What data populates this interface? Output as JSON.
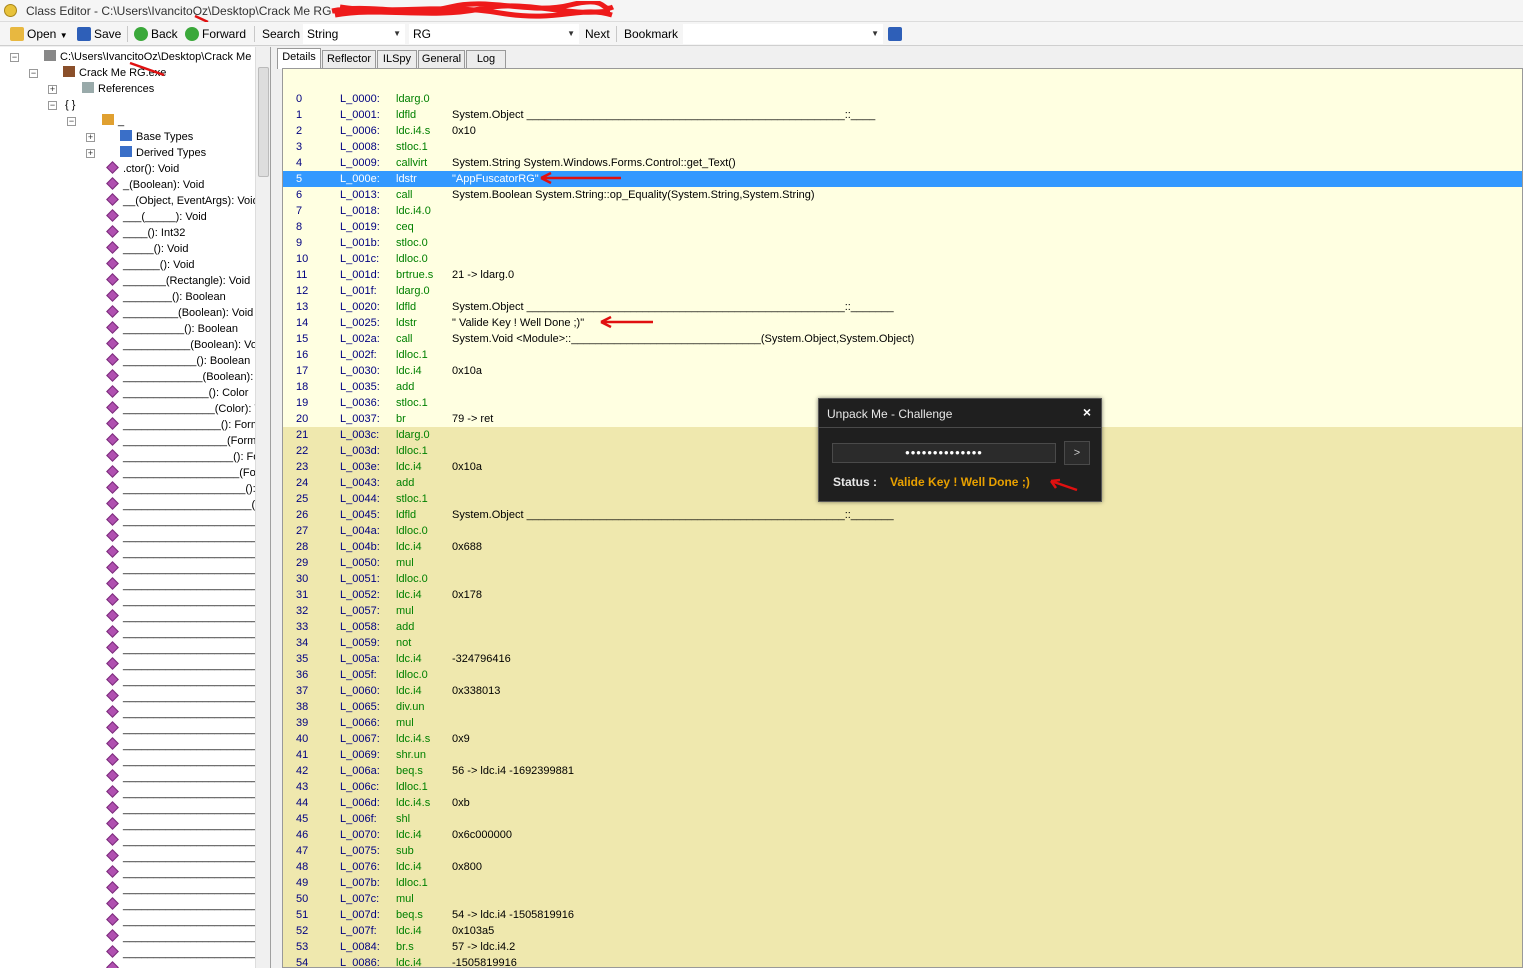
{
  "window": {
    "title": "Class Editor - C:\\Users\\IvancitoOz\\Desktop\\Crack Me RG"
  },
  "toolbar": {
    "open_label": "Open",
    "save_label": "Save",
    "back_label": "Back",
    "forward_label": "Forward",
    "search_label": "Search",
    "search_type": "String",
    "search_value": "RG",
    "next_label": "Next",
    "bookmark_label": "Bookmark",
    "bookmark_value": ""
  },
  "tree": {
    "items": [
      {
        "text": "C:\\Users\\IvancitoOz\\Desktop\\Crack Me RG"
      },
      {
        "text": "Crack Me RG.exe"
      },
      {
        "text": "References"
      },
      {
        "text": "{ }"
      },
      {
        "text": "_"
      },
      {
        "text": "Base Types"
      },
      {
        "text": "Derived Types"
      },
      {
        "text": ".ctor(): Void"
      },
      {
        "text": "_(Boolean): Void"
      },
      {
        "text": "__(Object, EventArgs): Void"
      },
      {
        "text": "___(_____): Void"
      },
      {
        "text": "____(): Int32"
      },
      {
        "text": "_____(): Void"
      },
      {
        "text": "______(): Void"
      },
      {
        "text": "_______(Rectangle): Void"
      },
      {
        "text": "________(): Boolean"
      },
      {
        "text": "_________(Boolean): Void"
      },
      {
        "text": "__________(): Boolean"
      },
      {
        "text": "___________(Boolean): Void"
      },
      {
        "text": "____________(): Boolean"
      },
      {
        "text": "_____________(Boolean): Void"
      },
      {
        "text": "______________(): Color"
      },
      {
        "text": "_______________(Color): Void"
      },
      {
        "text": "________________(): Form"
      },
      {
        "text": "_________________(FormB"
      },
      {
        "text": "__________________(): Fo"
      },
      {
        "text": "___________________(For"
      },
      {
        "text": "____________________(): "
      },
      {
        "text": "_____________________(B"
      }
    ],
    "blank_label": "______________________________"
  },
  "tabs": [
    "Details",
    "Reflector",
    "ILSpy",
    "General",
    "Log"
  ],
  "code": [
    {
      "n": "0",
      "label": "L_0000:",
      "op": "ldarg.0",
      "operand": ""
    },
    {
      "n": "1",
      "label": "L_0001:",
      "op": "ldfld",
      "operand": "System.Object ____________________________________________________::____"
    },
    {
      "n": "2",
      "label": "L_0006:",
      "op": "ldc.i4.s",
      "operand": "0x10"
    },
    {
      "n": "3",
      "label": "L_0008:",
      "op": "stloc.1",
      "operand": ""
    },
    {
      "n": "4",
      "label": "L_0009:",
      "op": "callvirt",
      "operand": "System.String System.Windows.Forms.Control::get_Text()"
    },
    {
      "n": "5",
      "label": "L_000e:",
      "op": "ldstr",
      "operand": "\"AppFuscatorRG\""
    },
    {
      "n": "6",
      "label": "L_0013:",
      "op": "call",
      "operand": "System.Boolean System.String::op_Equality(System.String,System.String)"
    },
    {
      "n": "7",
      "label": "L_0018:",
      "op": "ldc.i4.0",
      "operand": ""
    },
    {
      "n": "8",
      "label": "L_0019:",
      "op": "ceq",
      "operand": ""
    },
    {
      "n": "9",
      "label": "L_001b:",
      "op": "stloc.0",
      "operand": ""
    },
    {
      "n": "10",
      "label": "L_001c:",
      "op": "ldloc.0",
      "operand": ""
    },
    {
      "n": "11",
      "label": "L_001d:",
      "op": "brtrue.s",
      "operand": "21 -> ldarg.0"
    },
    {
      "n": "12",
      "label": "L_001f:",
      "op": "ldarg.0",
      "operand": ""
    },
    {
      "n": "13",
      "label": "L_0020:",
      "op": "ldfld",
      "operand": "System.Object ____________________________________________________::_______"
    },
    {
      "n": "14",
      "label": "L_0025:",
      "op": "ldstr",
      "operand": "\"  Valide Key ! Well Done ;)\""
    },
    {
      "n": "15",
      "label": "L_002a:",
      "op": "call",
      "operand": "System.Void <Module>::_______________________________(System.Object,System.Object)"
    },
    {
      "n": "16",
      "label": "L_002f:",
      "op": "ldloc.1",
      "operand": ""
    },
    {
      "n": "17",
      "label": "L_0030:",
      "op": "ldc.i4",
      "operand": "0x10a"
    },
    {
      "n": "18",
      "label": "L_0035:",
      "op": "add",
      "operand": ""
    },
    {
      "n": "19",
      "label": "L_0036:",
      "op": "stloc.1",
      "operand": ""
    },
    {
      "n": "20",
      "label": "L_0037:",
      "op": "br",
      "operand": "79 -> ret"
    },
    {
      "n": "21",
      "label": "L_003c:",
      "op": "ldarg.0",
      "operand": ""
    },
    {
      "n": "22",
      "label": "L_003d:",
      "op": "ldloc.1",
      "operand": ""
    },
    {
      "n": "23",
      "label": "L_003e:",
      "op": "ldc.i4",
      "operand": "0x10a"
    },
    {
      "n": "24",
      "label": "L_0043:",
      "op": "add",
      "operand": ""
    },
    {
      "n": "25",
      "label": "L_0044:",
      "op": "stloc.1",
      "operand": ""
    },
    {
      "n": "26",
      "label": "L_0045:",
      "op": "ldfld",
      "operand": "System.Object ____________________________________________________::_______"
    },
    {
      "n": "27",
      "label": "L_004a:",
      "op": "ldloc.0",
      "operand": ""
    },
    {
      "n": "28",
      "label": "L_004b:",
      "op": "ldc.i4",
      "operand": "0x688"
    },
    {
      "n": "29",
      "label": "L_0050:",
      "op": "mul",
      "operand": ""
    },
    {
      "n": "30",
      "label": "L_0051:",
      "op": "ldloc.0",
      "operand": ""
    },
    {
      "n": "31",
      "label": "L_0052:",
      "op": "ldc.i4",
      "operand": "0x178"
    },
    {
      "n": "32",
      "label": "L_0057:",
      "op": "mul",
      "operand": ""
    },
    {
      "n": "33",
      "label": "L_0058:",
      "op": "add",
      "operand": ""
    },
    {
      "n": "34",
      "label": "L_0059:",
      "op": "not",
      "operand": ""
    },
    {
      "n": "35",
      "label": "L_005a:",
      "op": "ldc.i4",
      "operand": "-324796416"
    },
    {
      "n": "36",
      "label": "L_005f:",
      "op": "ldloc.0",
      "operand": ""
    },
    {
      "n": "37",
      "label": "L_0060:",
      "op": "ldc.i4",
      "operand": "0x338013"
    },
    {
      "n": "38",
      "label": "L_0065:",
      "op": "div.un",
      "operand": ""
    },
    {
      "n": "39",
      "label": "L_0066:",
      "op": "mul",
      "operand": ""
    },
    {
      "n": "40",
      "label": "L_0067:",
      "op": "ldc.i4.s",
      "operand": "0x9"
    },
    {
      "n": "41",
      "label": "L_0069:",
      "op": "shr.un",
      "operand": ""
    },
    {
      "n": "42",
      "label": "L_006a:",
      "op": "beq.s",
      "operand": "56 -> ldc.i4 -1692399881"
    },
    {
      "n": "43",
      "label": "L_006c:",
      "op": "ldloc.1",
      "operand": ""
    },
    {
      "n": "44",
      "label": "L_006d:",
      "op": "ldc.i4.s",
      "operand": "0xb"
    },
    {
      "n": "45",
      "label": "L_006f:",
      "op": "shl",
      "operand": ""
    },
    {
      "n": "46",
      "label": "L_0070:",
      "op": "ldc.i4",
      "operand": "0x6c000000"
    },
    {
      "n": "47",
      "label": "L_0075:",
      "op": "sub",
      "operand": ""
    },
    {
      "n": "48",
      "label": "L_0076:",
      "op": "ldc.i4",
      "operand": "0x800"
    },
    {
      "n": "49",
      "label": "L_007b:",
      "op": "ldloc.1",
      "operand": ""
    },
    {
      "n": "50",
      "label": "L_007c:",
      "op": "mul",
      "operand": ""
    },
    {
      "n": "51",
      "label": "L_007d:",
      "op": "beq.s",
      "operand": "54 -> ldc.i4 -1505819916"
    },
    {
      "n": "52",
      "label": "L_007f:",
      "op": "ldc.i4",
      "operand": "0x103a5"
    },
    {
      "n": "53",
      "label": "L_0084:",
      "op": "br.s",
      "operand": "57 -> ldc.i4.2"
    },
    {
      "n": "54",
      "label": "L_0086:",
      "op": "ldc.i4",
      "operand": "-1505819916"
    }
  ],
  "dialog": {
    "title": "Unpack Me - Challenge",
    "close": "×",
    "password": "••••••••••••••",
    "go": ">",
    "status_label": "Status :",
    "status_value": "Valide Key ! Well Done ;)"
  },
  "colors": {
    "selection": "#3399ff",
    "code_bg": "#ffffe1",
    "code_bg_dark": "#efe8ae",
    "opcode": "#008000",
    "label": "#000080",
    "annotation_arrow": "#e01010",
    "status_accent": "#e8a000"
  }
}
